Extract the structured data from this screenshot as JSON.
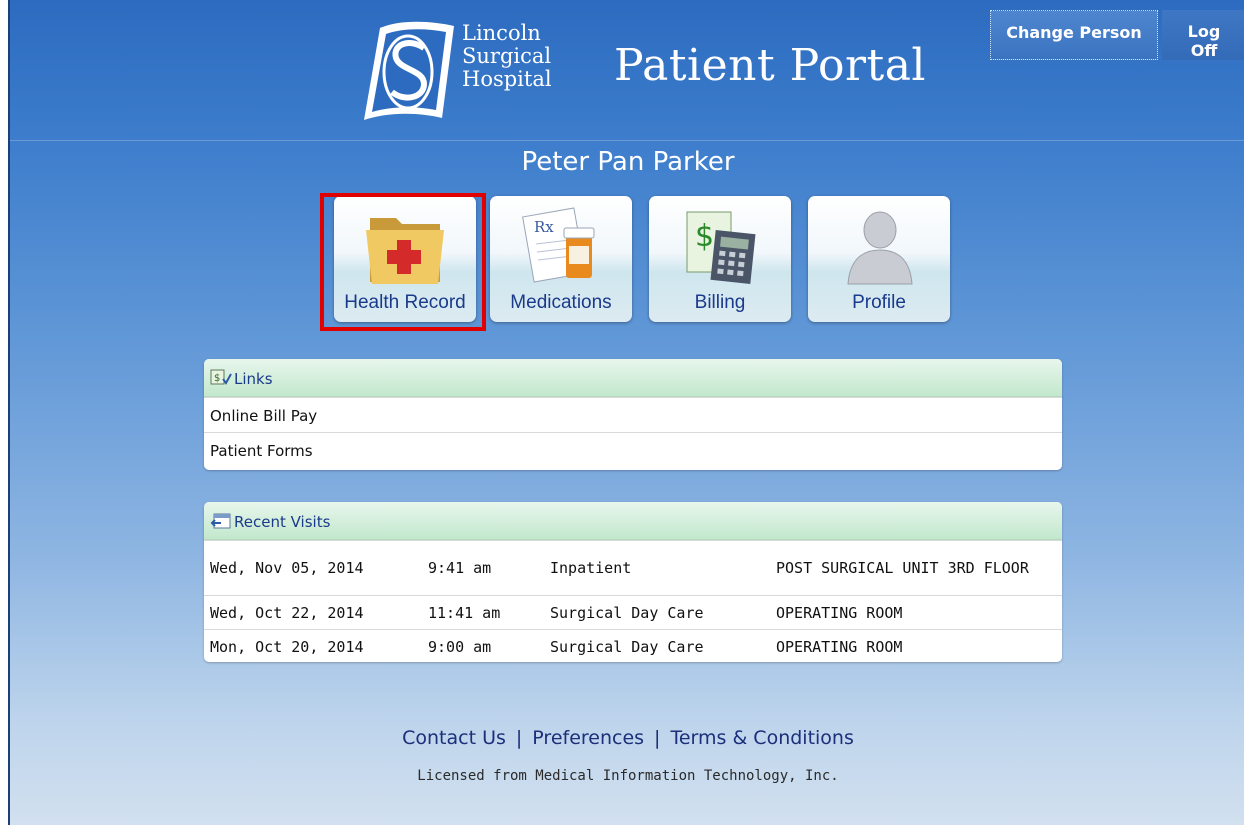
{
  "header": {
    "logo_lines": [
      "Lincoln",
      "Surgical",
      "Hospital"
    ],
    "title": "Patient Portal",
    "change_person": "Change Person",
    "log_off": "Log Off"
  },
  "patient": {
    "name": "Peter Pan Parker"
  },
  "tiles": [
    {
      "label": "Health Record",
      "icon": "folder-medical-icon",
      "selected": true
    },
    {
      "label": "Medications",
      "icon": "prescription-icon",
      "selected": false
    },
    {
      "label": "Billing",
      "icon": "calculator-dollar-icon",
      "selected": false
    },
    {
      "label": "Profile",
      "icon": "person-icon",
      "selected": false
    }
  ],
  "links_panel": {
    "title": "Links",
    "items": [
      "Online Bill Pay",
      "Patient Forms"
    ]
  },
  "visits_panel": {
    "title": "Recent Visits",
    "rows": [
      {
        "date": "Wed, Nov 05, 2014",
        "time": "9:41 am",
        "type": "Inpatient",
        "location": "POST SURGICAL UNIT 3RD FLOOR"
      },
      {
        "date": "Wed, Oct 22, 2014",
        "time": "11:41 am",
        "type": "Surgical Day Care",
        "location": "OPERATING ROOM"
      },
      {
        "date": "Mon, Oct 20, 2014",
        "time": "9:00 am",
        "type": "Surgical Day Care",
        "location": "OPERATING ROOM"
      }
    ]
  },
  "footer": {
    "links": [
      "Contact Us",
      "Preferences",
      "Terms & Conditions"
    ],
    "separator": "|",
    "license": "Licensed from Medical Information Technology, Inc."
  },
  "colors": {
    "accent_blue": "#2c6bbf",
    "selected_outline": "#e00000",
    "panel_header_green": "#c3e8cd",
    "label_navy": "#1a3a8a"
  }
}
